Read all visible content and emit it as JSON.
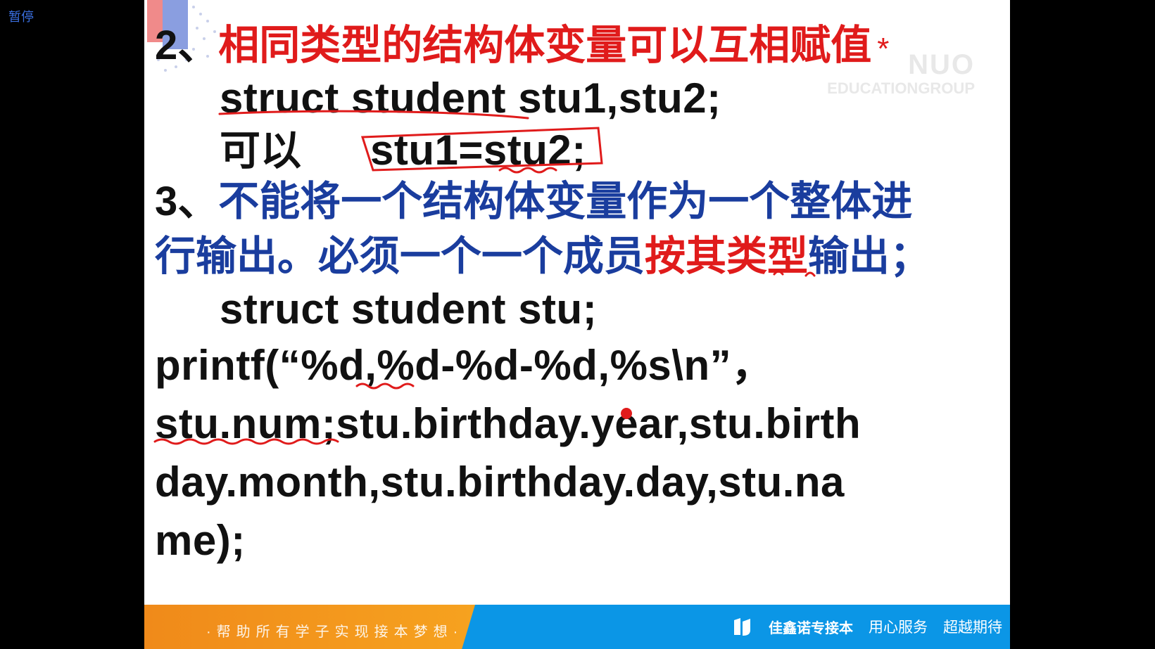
{
  "player": {
    "pause_label": "暂停"
  },
  "watermark": {
    "line1": "NUO",
    "line2": "EDUCATIONGROUP"
  },
  "slide": {
    "point2": {
      "number": "2、",
      "text": "相同类型的结构体变量可以互相赋值",
      "mark": "*"
    },
    "point2_code": "struct student stu1,stu2;",
    "point2_can": "可以",
    "point2_assign": "stu1=stu2;",
    "point3": {
      "number": "3、",
      "text_line1": "不能将一个结构体变量作为一个整体进",
      "text_line2a": "行输出。必须一个一个成员",
      "text_line2b": "按其类型",
      "text_line2c": "输出；"
    },
    "code_lines": [
      "struct student stu;",
      "printf(“%d,%d-%d-%d,%s\\n”，",
      "stu.num;stu.birthday.year,stu.birth",
      "day.month,stu.birthday.day,stu.na",
      "me);"
    ]
  },
  "footer": {
    "slogan": "·帮助所有学子实现接本梦想·",
    "brand": "佳鑫诺专接本",
    "motto1": "用心服务",
    "motto2": "超越期待"
  },
  "colors": {
    "red": "#e01b1b",
    "blue": "#1a3d9e",
    "footer_blue": "#0b96e6",
    "footer_orange": "#f08a1a"
  }
}
